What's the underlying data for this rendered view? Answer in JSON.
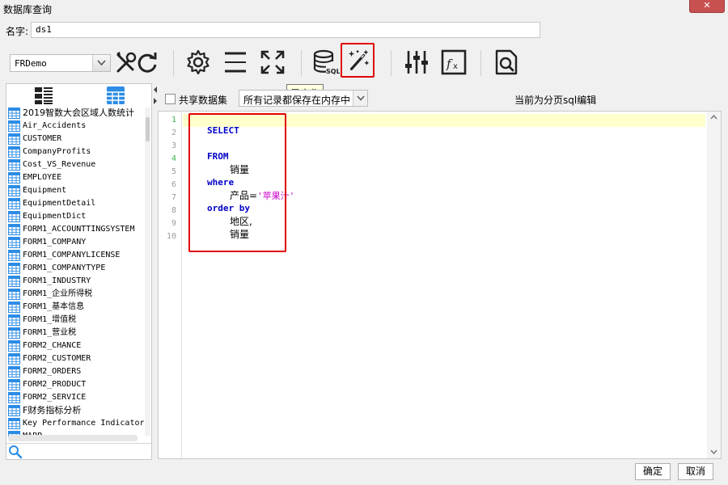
{
  "window": {
    "title": "数据库查询",
    "close_label": "✕"
  },
  "name_row": {
    "label": "名字:",
    "value": "ds1"
  },
  "datasource": {
    "selected": "FRDemo"
  },
  "toolbar": {
    "buttons": [
      "edit-connection",
      "refresh",
      "settings",
      "collapse",
      "maximize",
      "sql",
      "magic-wand",
      "parameters",
      "formula",
      "preview"
    ],
    "tooltip": "最大化"
  },
  "table_list": {
    "items": [
      "2019智数大会区域人数统计",
      "Air_Accidents",
      "CUSTOMER",
      "CompanyProfits",
      "Cost_VS_Revenue",
      "EMPLOYEE",
      "Equipment",
      "EquipmentDetail",
      "EquipmentDict",
      "FORM1_ACCOUNTTINGSYSTEM",
      "FORM1_COMPANY",
      "FORM1_COMPANYLICENSE",
      "FORM1_COMPANYTYPE",
      "FORM1_INDUSTRY",
      "FORM1_企业所得税",
      "FORM1_基本信息",
      "FORM1_增值税",
      "FORM1_营业税",
      "FORM2_CHANCE",
      "FORM2_CUSTOMER",
      "FORM2_ORDERS",
      "FORM2_PRODUCT",
      "FORM2_SERVICE",
      "F财务指标分析",
      "Key Performance Indicator",
      "MAPP"
    ]
  },
  "options": {
    "share_label": "共享数据集",
    "mode_value": "所有记录都保存在内存中",
    "status": "当前为分页sql编辑"
  },
  "editor": {
    "line_numbers": [
      "1",
      "2",
      "3",
      "4",
      "5",
      "6",
      "7",
      "8",
      "9",
      "10"
    ],
    "code": {
      "l2": "SELECT",
      "l4": "FROM",
      "l5": "销量",
      "l6": "where",
      "l7_field": "产品=",
      "l7_str": "'苹果汁'",
      "l8": "order by",
      "l9": "地区,",
      "l10": "销量"
    }
  },
  "footer": {
    "ok_label": "确定",
    "cancel_label": "取消"
  },
  "colors": {
    "highlight_box": "#e00000",
    "keyword": "#0000c8",
    "string": "#c800c8",
    "current_line": "#ffffcc",
    "tooltip_bg": "#ffffe1"
  }
}
